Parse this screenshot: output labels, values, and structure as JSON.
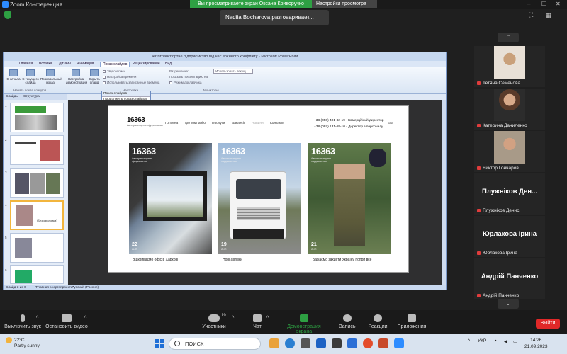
{
  "zoom": {
    "window_title": "Zoom Конференция",
    "share_banner": "Вы просматриваете экран Оксана Криворучко",
    "view_options": "Настройки просмотра",
    "speaking": "Nadiia Bocharova разговаривает...",
    "window_controls": [
      "–",
      "☐",
      "✕"
    ]
  },
  "ppt": {
    "title": "Автотранспортне підприємство під час воєнного конфлікту - Microsoft PowerPoint",
    "tabs": [
      "Главная",
      "Вставка",
      "Дизайн",
      "Анимация",
      "Показ слайдов",
      "Рецензирование",
      "Вид"
    ],
    "active_tab": "Показ слайдов",
    "ribbon_buttons": [
      "С начала",
      "С текущего слайда",
      "Произвольный показ",
      "Настройка демонстрации",
      "Скрыть слайд"
    ],
    "ribbon_lines": [
      "Звукозапись",
      "Настройка времени",
      "Использовать записанные времена",
      "Разрешение:",
      "Показать презентацию на:",
      "Режим докладчика"
    ],
    "resolution_value": "Использовать текущ...",
    "group_labels": [
      "Начать показ слайдов",
      "Настройка",
      "Мониторы"
    ],
    "popup_title": "Показ слайдов",
    "popup_item": "Продолжить показ слайдов",
    "slide_tabs": [
      "Слайды",
      "Структура"
    ],
    "thumb_note": "(Без заголовка)",
    "status": [
      "Слайд 3 из 6",
      "\"Главная энергопроекта\"",
      "Русский (Россия)"
    ]
  },
  "slide": {
    "logo": "16363",
    "logo_sub": "Автотранспортне підприємство",
    "nav": [
      "Головна",
      "Про компанію",
      "Послуги",
      "Вакансії",
      "Новини",
      "Контакти"
    ],
    "contacts": [
      "+38 (050) 401-82-19 - Комерційний директор",
      "+38 (097) 131-68-10 - Директор з персоналу"
    ],
    "lang": "EN",
    "cards": [
      {
        "big": "16363",
        "tag": "Автотранспортне підприємство",
        "date": "22",
        "month": "ЛИП",
        "caption": "Відкриваємо офіс в Харкові"
      },
      {
        "big": "16363",
        "tag": "Автотранспортне підприємство",
        "date": "19",
        "month": "ЛИП",
        "caption": "Нові автівки"
      },
      {
        "big": "16363",
        "tag": "Автотранспортне підприємство",
        "date": "21",
        "month": "ЛИП",
        "caption": "Бажаємо захисти Україну попри все"
      }
    ]
  },
  "participants": [
    {
      "name": "Тетяна Семенова",
      "type": "video"
    },
    {
      "name": "Катерина Даниленко",
      "type": "video"
    },
    {
      "name": "Виктор Гончаров",
      "type": "video"
    },
    {
      "big": "Плужніков Ден...",
      "name": "Плужніков Денис",
      "type": "text"
    },
    {
      "big": "Юрлакова Ірина",
      "name": "Юрлакова Ірина",
      "type": "text"
    },
    {
      "big": "Андрій Панченко",
      "name": "Андрій Панченко",
      "type": "text"
    }
  ],
  "toolbar": {
    "mute": "Выключить звук",
    "video": "Остановить видео",
    "participants": "Участники",
    "participants_count": "19",
    "chat": "Чат",
    "share": "Демонстрация экрана",
    "record": "Запись",
    "reactions": "Реакции",
    "apps": "Приложения",
    "exit": "Выйти"
  },
  "taskbar": {
    "temp": "22°C",
    "weather": "Partly sunny",
    "search_placeholder": "ПОИСК",
    "lang": "УКР",
    "time": "14:26",
    "date": "21.09.2023"
  },
  "colors": {
    "zoom_green": "#2ea043",
    "exit_red": "#e02828",
    "mute_red": "#e03c3c"
  }
}
